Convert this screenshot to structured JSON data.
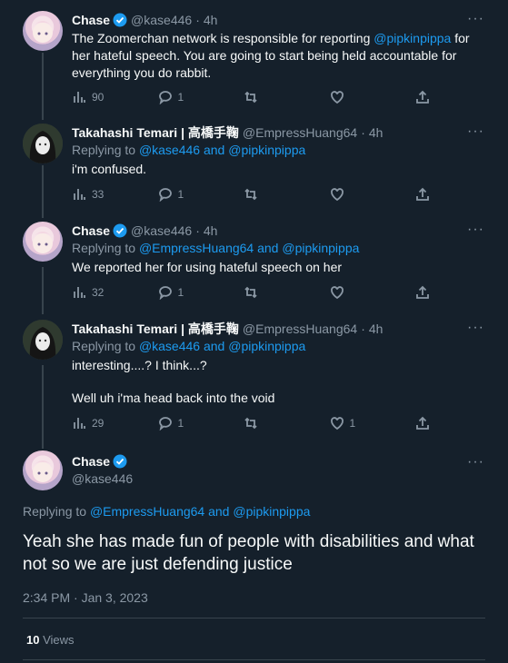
{
  "replies": [
    {
      "name": "Chase",
      "verified": true,
      "handle": "@kase446",
      "time": "4h",
      "replying_prefix": "",
      "replying_to": [],
      "text": "The Zoomerchan network is responsible for reporting @pipkinpippa for her hateful speech. You are going to start being held accountable for everything you do rabbit.",
      "text_parts": [
        "The Zoomerchan network is responsible for reporting ",
        "@pipkinpippa",
        " for her hateful speech. You are going to start being held accountable for everything you do rabbit."
      ],
      "views": "90",
      "replies": "1",
      "retweets": "",
      "likes": ""
    },
    {
      "name": "Takahashi Temari | 高橋手鞠",
      "verified": false,
      "handle": "@EmpressHuang64",
      "time": "4h",
      "replying_prefix": "Replying to",
      "replying_to": [
        "@kase446",
        "and",
        "@pipkinpippa"
      ],
      "text": "i'm confused.",
      "views": "33",
      "replies": "1",
      "retweets": "",
      "likes": ""
    },
    {
      "name": "Chase",
      "verified": true,
      "handle": "@kase446",
      "time": "4h",
      "replying_prefix": "Replying to",
      "replying_to": [
        "@EmpressHuang64",
        "and",
        "@pipkinpippa"
      ],
      "text": "We reported her for using hateful speech on her",
      "views": "32",
      "replies": "1",
      "retweets": "",
      "likes": ""
    },
    {
      "name": "Takahashi Temari | 高橋手鞠",
      "verified": false,
      "handle": "@EmpressHuang64",
      "time": "4h",
      "replying_prefix": "Replying to",
      "replying_to": [
        "@kase446",
        "and",
        "@pipkinpippa"
      ],
      "text": "interesting....? I think...?",
      "text2": "Well uh i'ma head back into the void",
      "views": "29",
      "replies": "1",
      "retweets": "",
      "likes": "1"
    }
  ],
  "main": {
    "name": "Chase",
    "verified": true,
    "handle": "@kase446",
    "replying_prefix": "Replying to",
    "replying_to": [
      "@EmpressHuang64",
      "and",
      "@pipkinpippa"
    ],
    "text": "Yeah she has made fun of people with disabilities and what not so we are just defending justice",
    "timestamp": "2:34 PM · Jan 3, 2023",
    "views_count": "10",
    "views_label": "Views"
  },
  "more_glyph": "···",
  "dot": "·",
  "colors": {
    "background": "#15202b",
    "link": "#1d9bf0",
    "muted": "#8b98a5",
    "verified": "#1d9bf0"
  }
}
